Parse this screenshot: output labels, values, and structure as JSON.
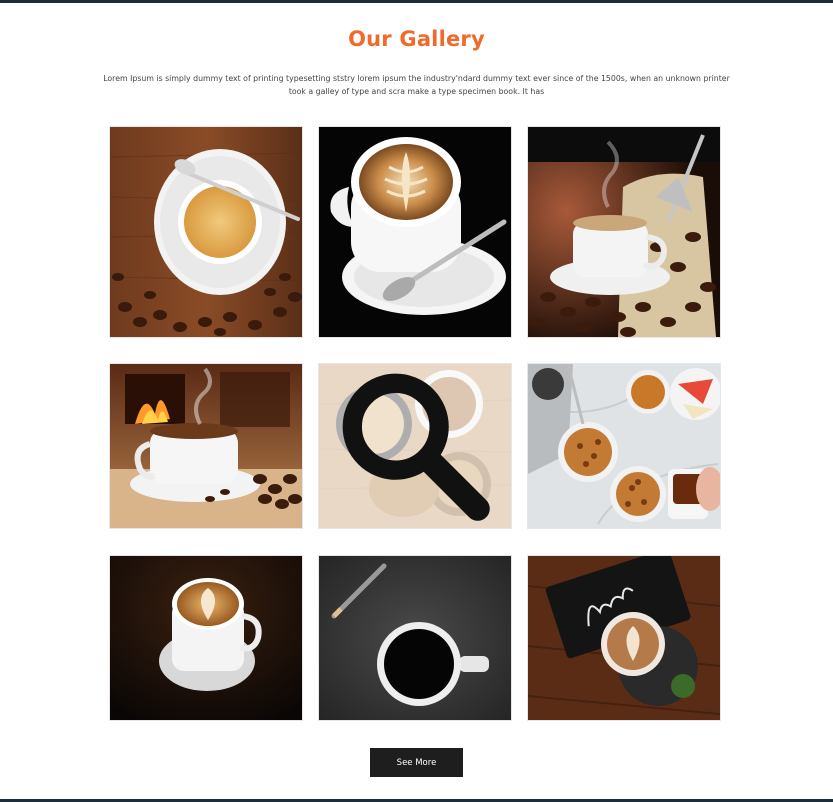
{
  "gallery": {
    "title": "Our Gallery",
    "description": "Lorem Ipsum is simply dummy text of printing typesetting ststry lorem ipsum the industry'ndard dummy text ever since of the 1500s, when an unknown printer took a galley of type and scra make a type specimen book. It has",
    "images": [
      {
        "name": "latte-on-saucer-wood-beans"
      },
      {
        "name": "latte-art-cup-black"
      },
      {
        "name": "steaming-cup-coffee-sack-scoop"
      },
      {
        "name": "coffee-cup-fireplace"
      },
      {
        "name": "coffee-cups-muffin-hovered"
      },
      {
        "name": "coffee-granola-bowls-marble"
      },
      {
        "name": "latte-art-cup-dark"
      },
      {
        "name": "black-coffee-pencil-gray"
      },
      {
        "name": "latte-thanks-card"
      }
    ],
    "hover_icon": "search-icon",
    "see_more_label": "See More"
  },
  "colors": {
    "accent": "#f06b2b",
    "button_bg": "#1e1e1e",
    "frame": "#1d2d3a"
  }
}
